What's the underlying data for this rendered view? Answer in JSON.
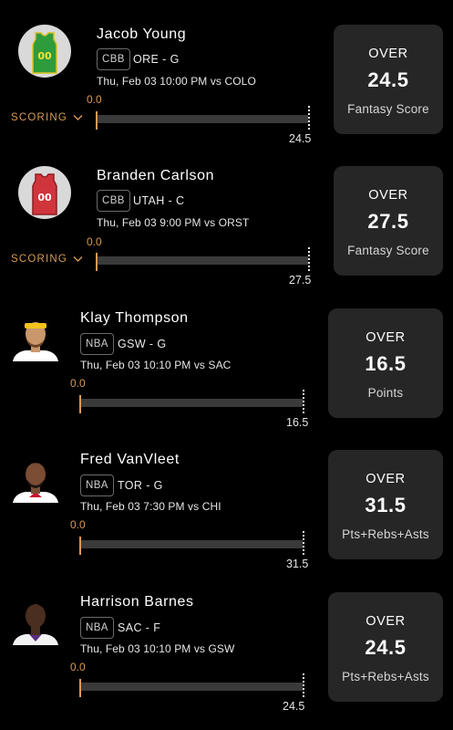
{
  "picks": [
    {
      "player": "Jacob Young",
      "avatar": "jersey-avatar",
      "jersey_number": "00",
      "jersey_color": "#2e9b3c",
      "jersey_trim": "#d7c31f",
      "jersey_text_color": "#f2e33a",
      "league": "CBB",
      "team_position": "ORE - G",
      "game": "Thu, Feb 03 10:00 PM vs COLO",
      "scoring_label": "SCORING",
      "current_value": "0.0",
      "line_label": "24.5",
      "direction": "OVER",
      "line": "24.5",
      "stat": "Fantasy Score"
    },
    {
      "player": "Branden Carlson",
      "avatar": "jersey-avatar",
      "jersey_number": "00",
      "jersey_color": "#d0353b",
      "jersey_trim": "#8d1d22",
      "jersey_text_color": "#ffffff",
      "league": "CBB",
      "team_position": "UTAH - C",
      "game": "Thu, Feb 03 9:00 PM vs ORST",
      "scoring_label": "SCORING",
      "current_value": "0.0",
      "line_label": "27.5",
      "direction": "OVER",
      "line": "27.5",
      "stat": "Fantasy Score"
    },
    {
      "player": "Klay Thompson",
      "avatar": "player-photo-avatar",
      "skin_color": "#c9976b",
      "headband_color": "#f3c21d",
      "shirt_color": "#ffffff",
      "league": "NBA",
      "team_position": "GSW - G",
      "game": "Thu, Feb 03 10:10 PM vs SAC",
      "current_value": "0.0",
      "line_label": "16.5",
      "direction": "OVER",
      "line": "16.5",
      "stat": "Points"
    },
    {
      "player": "Fred VanVleet",
      "avatar": "player-photo-avatar",
      "skin_color": "#7a4d34",
      "headband_color": "",
      "shirt_color": "#ffffff",
      "league": "NBA",
      "team_position": "TOR - G",
      "game": "Thu, Feb 03 7:30 PM vs CHI",
      "current_value": "0.0",
      "line_label": "31.5",
      "direction": "OVER",
      "line": "31.5",
      "stat": "Pts+Rebs+Asts"
    },
    {
      "player": "Harrison Barnes",
      "avatar": "player-photo-avatar",
      "skin_color": "#4a2e20",
      "headband_color": "",
      "shirt_color": "#f2f2f2",
      "league": "NBA",
      "team_position": "SAC - F",
      "game": "Thu, Feb 03 10:10 PM vs GSW",
      "current_value": "0.0",
      "line_label": "24.5",
      "direction": "OVER",
      "line": "24.5",
      "stat": "Pts+Rebs+Asts"
    }
  ],
  "colors": {
    "background": "#000000",
    "card": "#262626",
    "accent": "#d89a55",
    "progress_track": "#3a3a3a"
  },
  "icons": {
    "scoring_toggle": "chevron-down-icon"
  }
}
